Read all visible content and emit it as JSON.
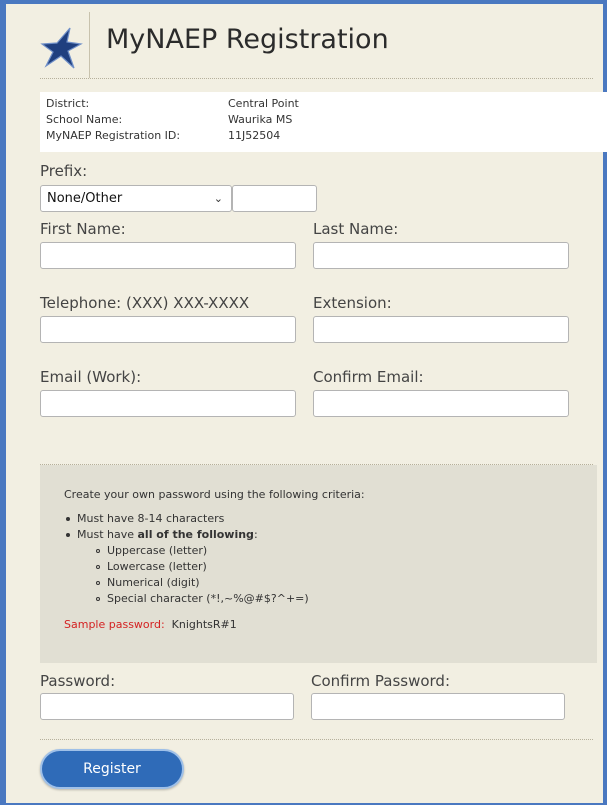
{
  "header": {
    "title": "MyNAEP Registration"
  },
  "info": [
    {
      "label": "District:",
      "value": "Central Point"
    },
    {
      "label": "School Name:",
      "value": "Waurika MS"
    },
    {
      "label": "MyNAEP Registration ID:",
      "value": "11J52504"
    }
  ],
  "form": {
    "prefix_label": "Prefix:",
    "prefix_selected": "None/Other",
    "first_name_label": "First Name:",
    "last_name_label": "Last Name:",
    "telephone_label": "Telephone: (XXX) XXX-XXXX",
    "extension_label": "Extension:",
    "email_label": "Email (Work):",
    "confirm_email_label": "Confirm Email:",
    "password_label": "Password:",
    "confirm_password_label": "Confirm Password:"
  },
  "criteria": {
    "intro": "Create your own password using the following criteria:",
    "length": "Must have 8-14 characters",
    "must_have_prefix": "Must have ",
    "must_have_bold": "all of the following",
    "must_have_suffix": ":",
    "items": [
      "Uppercase (letter)",
      "Lowercase (letter)",
      "Numerical (digit)",
      "Special character (*!,~%@#$?^+=)"
    ],
    "sample_label": "Sample password:",
    "sample_value": "KnightsR#1"
  },
  "buttons": {
    "register": "Register"
  },
  "colors": {
    "frame": "#4a78c0",
    "accent": "#2f6bb8",
    "sample_label": "#d42222",
    "background": "#f2efe2"
  }
}
